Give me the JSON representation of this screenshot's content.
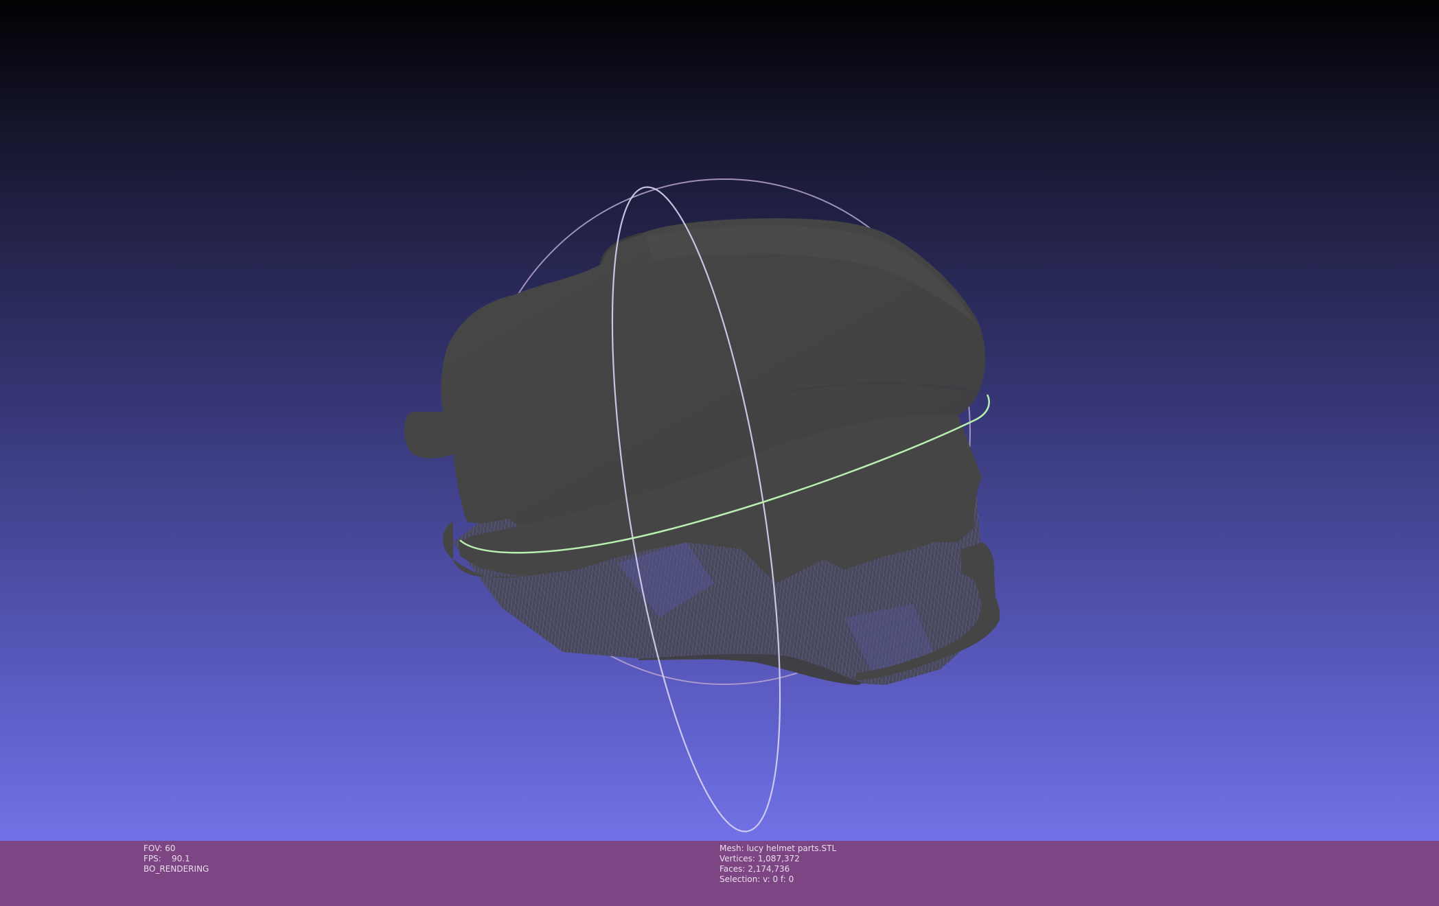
{
  "render_info": {
    "fov": "FOV: 60",
    "fps": "FPS:    90.1",
    "mode": "BO_RENDERING"
  },
  "mesh_info": {
    "mesh": "Mesh: lucy helmet parts.STL",
    "vertices": "Vertices: 1,087,372",
    "faces": "Faces: 2,174,736",
    "selection": "Selection: v: 0 f: 0"
  },
  "colors": {
    "infobar_bg": "#7e4585",
    "mesh_fill": "#454545",
    "trackball_horizontal": "#b8f0b0",
    "trackball_vertical": "#d8d4f4",
    "trackball_outer": "#b8a4d0"
  }
}
